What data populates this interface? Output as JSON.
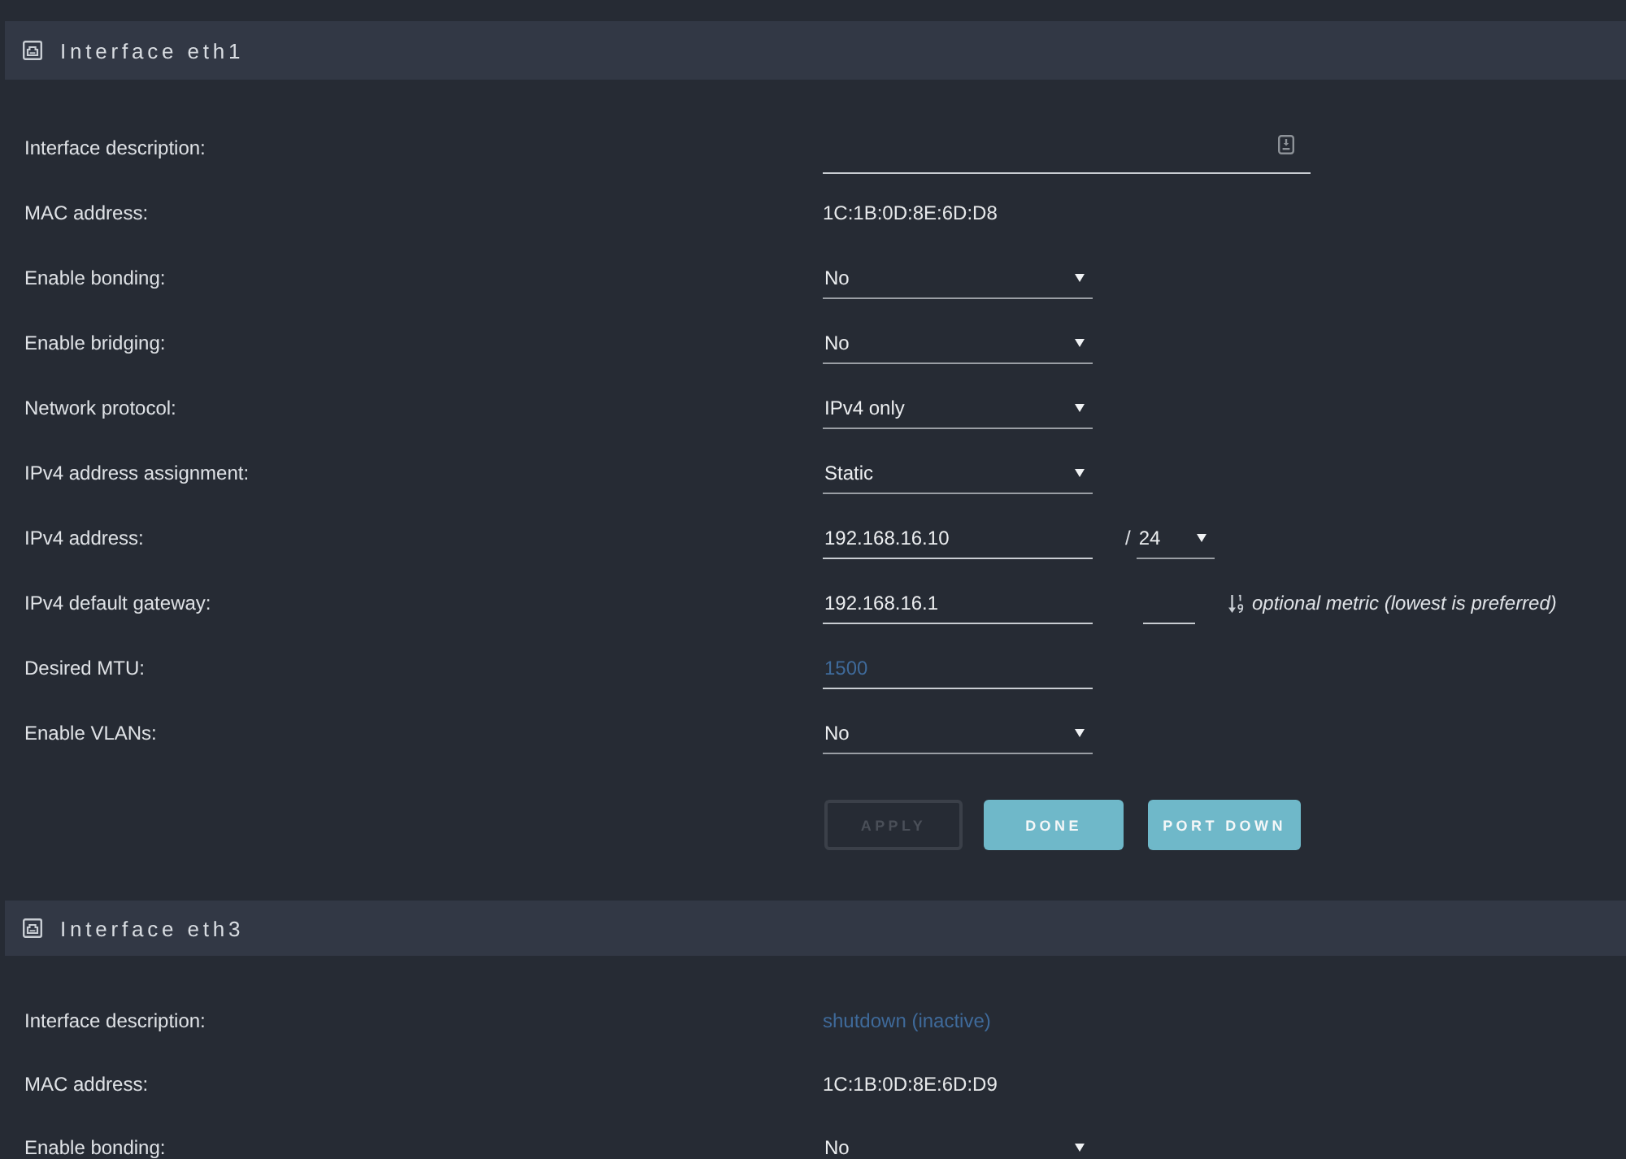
{
  "sections": [
    {
      "title": "Interface eth1",
      "rows": [
        {
          "label": "Interface description:",
          "kind": "input_with_icon"
        },
        {
          "label": "MAC address:",
          "kind": "text",
          "value": "1C:1B:0D:8E:6D:D8"
        },
        {
          "label": "Enable bonding:",
          "kind": "select",
          "value": "No"
        },
        {
          "label": "Enable bridging:",
          "kind": "select",
          "value": "No"
        },
        {
          "label": "Network protocol:",
          "kind": "select",
          "value": "IPv4 only"
        },
        {
          "label": "IPv4 address assignment:",
          "kind": "select",
          "value": "Static"
        },
        {
          "label": "IPv4 address:",
          "kind": "address",
          "value": "192.168.16.10",
          "separator": "/",
          "prefix": "24"
        },
        {
          "label": "IPv4 default gateway:",
          "kind": "gateway",
          "value": "192.168.16.1",
          "hint": "optional metric (lowest is preferred)"
        },
        {
          "label": "Desired MTU:",
          "kind": "input",
          "placeholder": "1500"
        },
        {
          "label": "Enable VLANs:",
          "kind": "select",
          "value": "No"
        }
      ],
      "buttons": [
        {
          "label": "APPLY",
          "disabled": true
        },
        {
          "label": "DONE",
          "disabled": false
        },
        {
          "label": "PORT DOWN",
          "disabled": false
        }
      ]
    },
    {
      "title": "Interface eth3",
      "rows": [
        {
          "label": "Interface description:",
          "kind": "status",
          "value": "shutdown (inactive)"
        },
        {
          "label": "MAC address:",
          "kind": "text",
          "value": "1C:1B:0D:8E:6D:D9"
        },
        {
          "label": "Enable bonding:",
          "kind": "select",
          "value": "No"
        }
      ]
    }
  ]
}
